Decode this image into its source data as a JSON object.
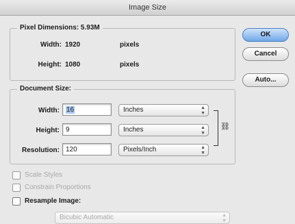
{
  "window": {
    "title": "Image Size"
  },
  "pixel_dimensions": {
    "legend": "Pixel Dimensions:",
    "size": "5.93M",
    "width_label": "Width:",
    "width_value": "1920",
    "width_unit": "pixels",
    "height_label": "Height:",
    "height_value": "1080",
    "height_unit": "pixels"
  },
  "document_size": {
    "legend": "Document Size:",
    "width_label": "Width:",
    "width_value": "16",
    "width_unit": "Inches",
    "height_label": "Height:",
    "height_value": "9",
    "height_unit": "Inches",
    "resolution_label": "Resolution:",
    "resolution_value": "120",
    "resolution_unit": "Pixels/Inch"
  },
  "buttons": {
    "ok": "OK",
    "cancel": "Cancel",
    "auto": "Auto..."
  },
  "options": {
    "scale_styles": "Scale Styles",
    "constrain_proportions": "Constrain Proportions",
    "resample_image": "Resample Image:",
    "resample_method": "Bicubic Automatic"
  }
}
